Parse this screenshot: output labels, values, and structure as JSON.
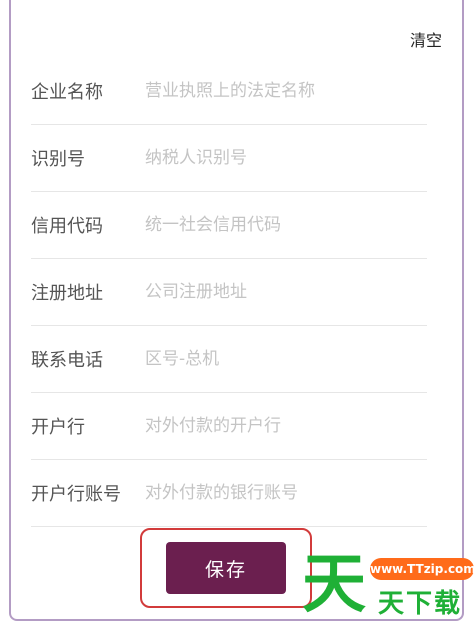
{
  "header": {
    "clear_label": "清空"
  },
  "form": {
    "fields": [
      {
        "label": "企业名称",
        "placeholder": "营业执照上的法定名称",
        "value": ""
      },
      {
        "label": "识别号",
        "placeholder": "纳税人识别号",
        "value": ""
      },
      {
        "label": "信用代码",
        "placeholder": "统一社会信用代码",
        "value": ""
      },
      {
        "label": "注册地址",
        "placeholder": "公司注册地址",
        "value": ""
      },
      {
        "label": "联系电话",
        "placeholder": "区号-总机",
        "value": ""
      },
      {
        "label": "开户行",
        "placeholder": "对外付款的开户行",
        "value": ""
      },
      {
        "label": "开户行账号",
        "placeholder": "对外付款的银行账号",
        "value": ""
      }
    ]
  },
  "actions": {
    "save_label": "保存"
  },
  "watermark": {
    "url": "www.TTzip.com",
    "big_char": "天",
    "text": "天下载"
  },
  "colors": {
    "primary": "#6b1f4f",
    "highlight": "#d23b3b",
    "frame": "#b39cc4",
    "placeholder": "#c4c4c4"
  }
}
